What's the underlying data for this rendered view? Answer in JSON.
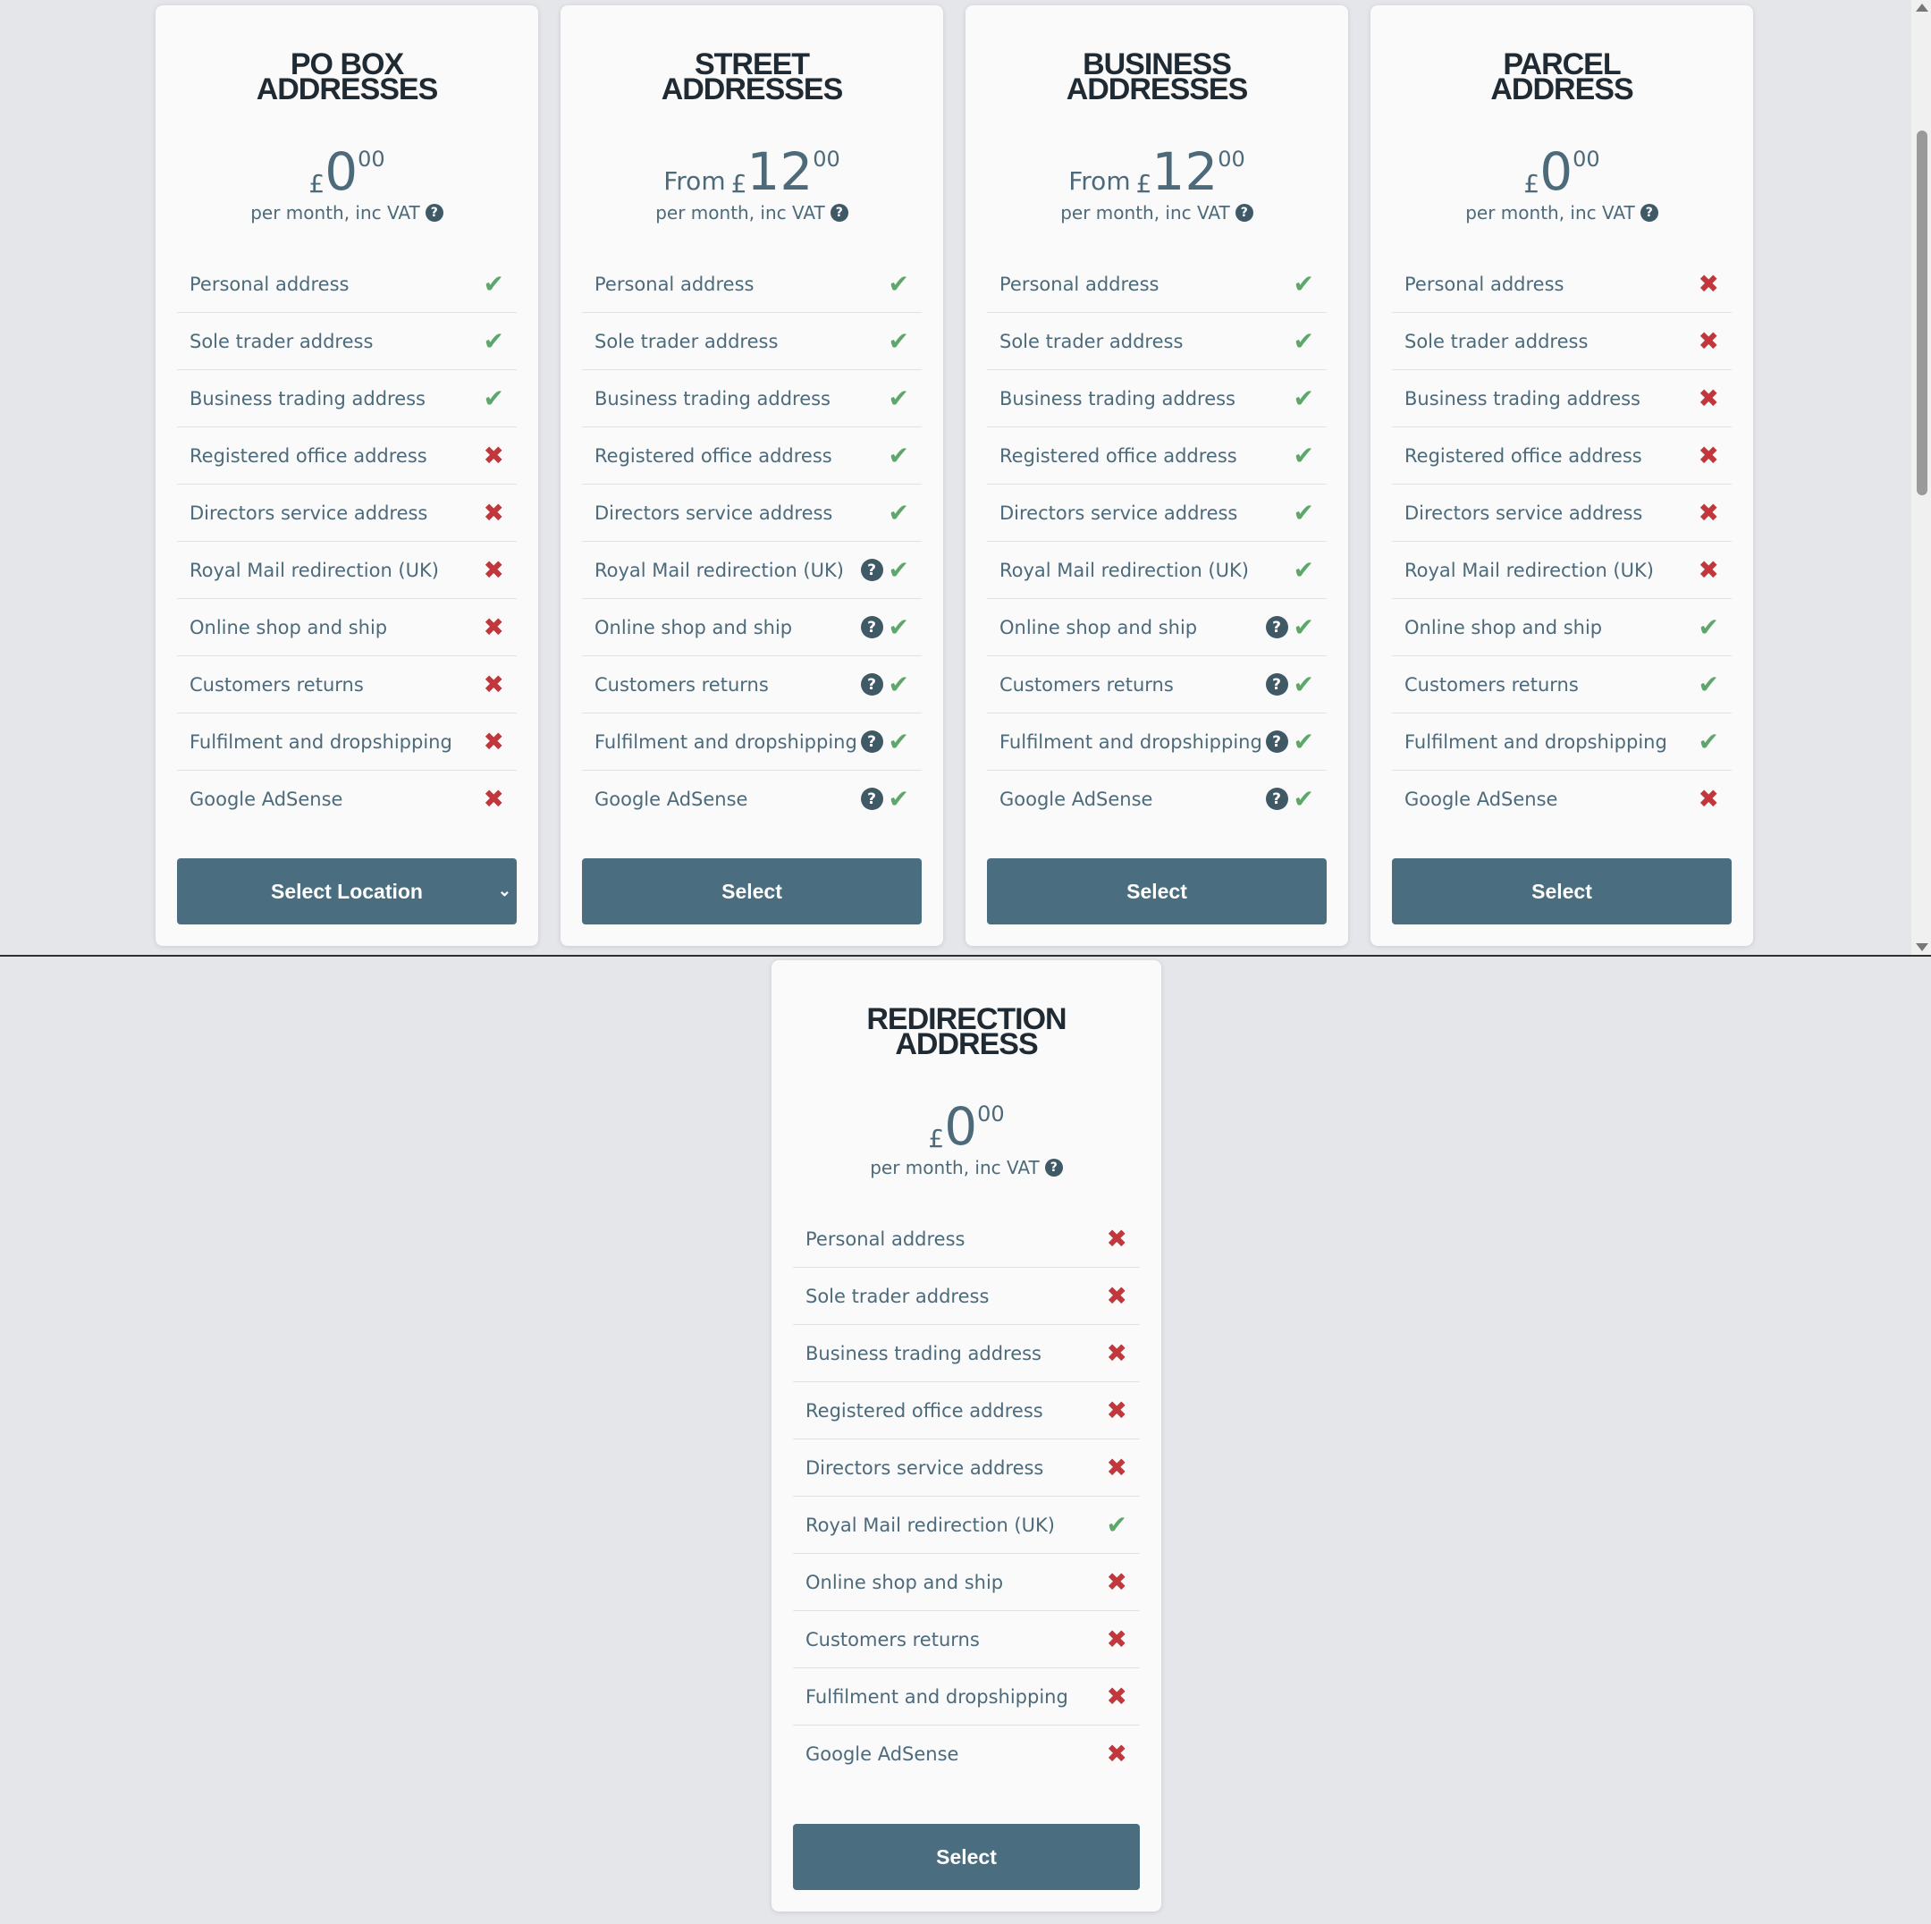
{
  "features": [
    "Personal address",
    "Sole trader address",
    "Business trading address",
    "Registered office address",
    "Directors service address",
    "Royal Mail redirection (UK)",
    "Online shop and ship",
    "Customers returns",
    "Fulfilment and dropshipping",
    "Google AdSense"
  ],
  "colors": {
    "check": "#5ea66a",
    "cross": "#c0383b",
    "button": "#4a6e80",
    "text": "#4d6a7a"
  },
  "plans": [
    {
      "title_line1": "PO BOX",
      "title_line2": "ADDRESSES",
      "price_prefix": "",
      "currency": "£",
      "price_main": "0",
      "price_cents": "00",
      "period": "per month, inc VAT",
      "includes": [
        true,
        true,
        true,
        false,
        false,
        false,
        false,
        false,
        false,
        false
      ],
      "info": [
        false,
        false,
        false,
        false,
        false,
        false,
        false,
        false,
        false,
        false
      ],
      "button_label": "Select Location",
      "button_dropdown": true
    },
    {
      "title_line1": "STREET",
      "title_line2": "ADDRESSES",
      "price_prefix": "From",
      "currency": "£",
      "price_main": "12",
      "price_cents": "00",
      "period": "per month, inc VAT",
      "includes": [
        true,
        true,
        true,
        true,
        true,
        true,
        true,
        true,
        true,
        true
      ],
      "info": [
        false,
        false,
        false,
        false,
        false,
        true,
        true,
        true,
        true,
        true
      ],
      "button_label": "Select",
      "button_dropdown": false
    },
    {
      "title_line1": "BUSINESS",
      "title_line2": "ADDRESSES",
      "price_prefix": "From",
      "currency": "£",
      "price_main": "12",
      "price_cents": "00",
      "period": "per month, inc VAT",
      "includes": [
        true,
        true,
        true,
        true,
        true,
        true,
        true,
        true,
        true,
        true
      ],
      "info": [
        false,
        false,
        false,
        false,
        false,
        false,
        true,
        true,
        true,
        true
      ],
      "button_label": "Select",
      "button_dropdown": false
    },
    {
      "title_line1": "PARCEL",
      "title_line2": "ADDRESS",
      "price_prefix": "",
      "currency": "£",
      "price_main": "0",
      "price_cents": "00",
      "period": "per month, inc VAT",
      "includes": [
        false,
        false,
        false,
        false,
        false,
        false,
        true,
        true,
        true,
        false
      ],
      "info": [
        false,
        false,
        false,
        false,
        false,
        false,
        false,
        false,
        false,
        false
      ],
      "button_label": "Select",
      "button_dropdown": false
    },
    {
      "title_line1": "REDIRECTION",
      "title_line2": "ADDRESS",
      "price_prefix": "",
      "currency": "£",
      "price_main": "0",
      "price_cents": "00",
      "period": "per month, inc VAT",
      "includes": [
        false,
        false,
        false,
        false,
        false,
        true,
        false,
        false,
        false,
        false
      ],
      "info": [
        false,
        false,
        false,
        false,
        false,
        false,
        false,
        false,
        false,
        false
      ],
      "button_label": "Select",
      "button_dropdown": false
    }
  ]
}
